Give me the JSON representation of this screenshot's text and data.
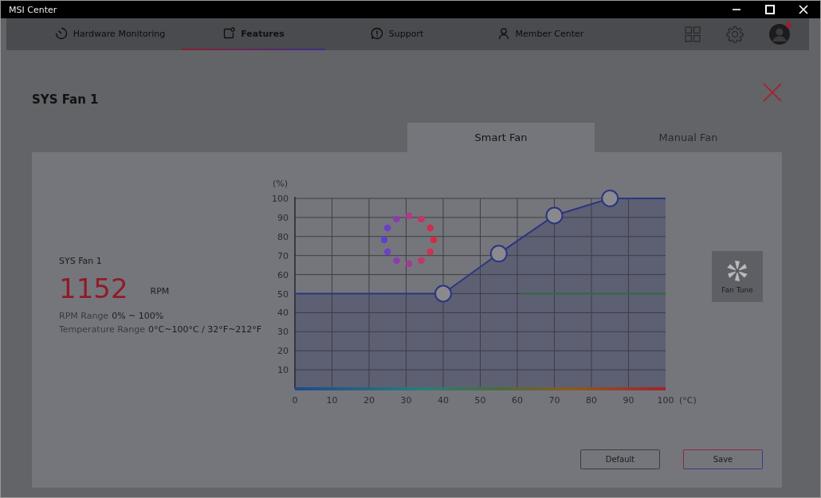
{
  "window": {
    "title": "MSI Center"
  },
  "nav": [
    {
      "label": "Hardware Monitoring",
      "selected": false
    },
    {
      "label": "Features",
      "selected": true
    },
    {
      "label": "Support",
      "selected": false
    },
    {
      "label": "Member Center",
      "selected": false
    }
  ],
  "notification": true,
  "dialog": {
    "title": "SYS Fan 1",
    "tabs": [
      {
        "label": "Smart Fan",
        "selected": true
      },
      {
        "label": "Manual Fan",
        "selected": false
      }
    ],
    "fan": {
      "name": "SYS Fan 1",
      "rpm": "1152",
      "unit": "RPM",
      "rpm_range_label": "RPM Range",
      "rpm_range": "0% ~ 100%",
      "temp_range_label": "Temperature Range",
      "temp_range": "0°C~100°C / 32°F~212°F"
    },
    "chart_data": {
      "type": "area",
      "grid": true,
      "xlabel": "(°C)",
      "ylabel": "(%)",
      "x": [
        0,
        40,
        55,
        61,
        70,
        85,
        100
      ],
      "series": [
        {
          "color": "#2c3580",
          "values": [
            50,
            50,
            71,
            79,
            91,
            100,
            100
          ]
        },
        {
          "type": "line",
          "color": "#2f6a3c",
          "values": [
            null,
            null,
            null,
            50,
            50,
            50,
            50
          ]
        }
      ],
      "xlim": [
        0,
        100
      ],
      "ylim": [
        0,
        100
      ],
      "xticks": [
        0,
        10,
        20,
        30,
        40,
        50,
        60,
        70,
        80,
        90,
        100
      ],
      "yticks": [
        10,
        20,
        30,
        40,
        50,
        60,
        70,
        80,
        90,
        100
      ]
    },
    "fan_tune": "Fan Tune",
    "buttons": [
      {
        "label": "Default",
        "kind": "plain"
      },
      {
        "label": "Save",
        "kind": "primary"
      }
    ]
  }
}
